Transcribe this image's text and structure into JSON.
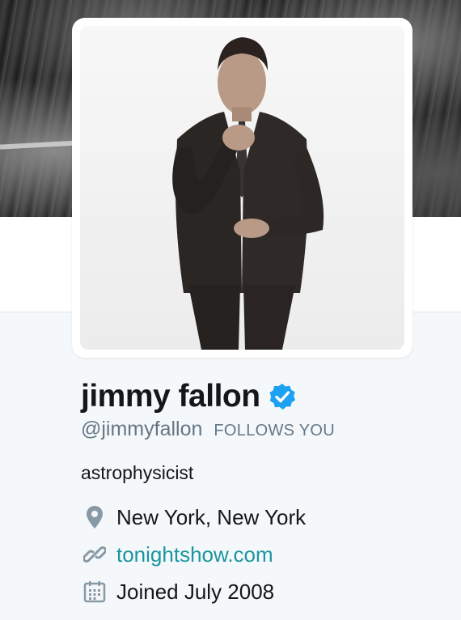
{
  "profile": {
    "display_name": "jimmy fallon",
    "handle": "@jimmyfallon",
    "follows_you_badge": "FOLLOWS YOU",
    "bio": "astrophysicist",
    "location": "New York, New York",
    "website": "tonightshow.com",
    "joined": "Joined July 2008",
    "verified": true
  },
  "icons": {
    "verified": "verified-badge-icon",
    "location": "location-pin-icon",
    "website": "link-icon",
    "joined": "calendar-icon"
  },
  "colors": {
    "verified_blue": "#1da1f2",
    "link_teal": "#1b95a0",
    "secondary_text": "#657786",
    "icon_gray": "#8899a6"
  }
}
